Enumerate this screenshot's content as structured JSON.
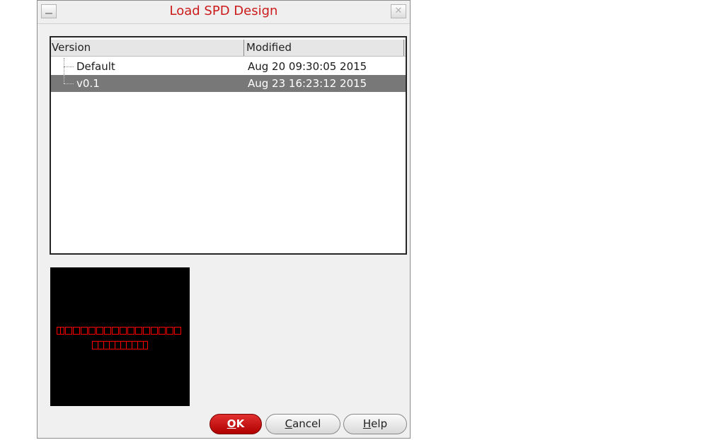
{
  "window": {
    "title": "Load SPD Design",
    "minimize_icon": "minimize-icon",
    "close_icon": "close-icon",
    "title_color": "#cc1b1b"
  },
  "table": {
    "columns": [
      "Version",
      "Modified"
    ],
    "rows": [
      {
        "version": "Default",
        "modified": "Aug 20 09:30:05 2015",
        "selected": false
      },
      {
        "version": "v0.1",
        "modified": "Aug 23 16:23:12 2015",
        "selected": true
      }
    ]
  },
  "preview": {
    "icon": "design-thumbnail",
    "background": "#000000",
    "accent": "#ff0000"
  },
  "buttons": {
    "ok": {
      "mnemonic": "O",
      "rest": "K"
    },
    "cancel": {
      "mnemonic": "C",
      "rest": "ancel"
    },
    "help": {
      "mnemonic": "H",
      "rest": "elp"
    }
  }
}
